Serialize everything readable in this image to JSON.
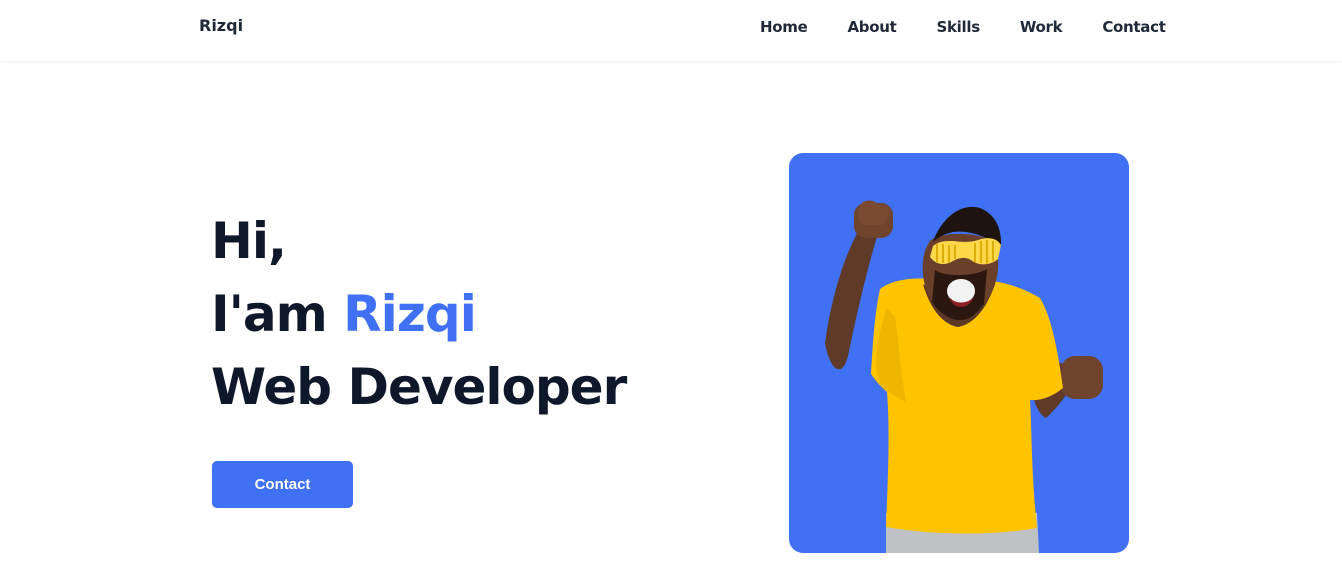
{
  "header": {
    "logo": "Rizqi",
    "nav": [
      {
        "label": "Home"
      },
      {
        "label": "About"
      },
      {
        "label": "Skills"
      },
      {
        "label": "Work"
      },
      {
        "label": "Contact"
      }
    ]
  },
  "hero": {
    "greeting": "Hi,",
    "intro_prefix": "I'am ",
    "name": "Rizqi",
    "role": "Web Developer",
    "contact_button": "Contact"
  },
  "colors": {
    "accent": "#4070f4",
    "text": "#0f172a",
    "background": "#ffffff",
    "shirt": "#ffc400"
  }
}
